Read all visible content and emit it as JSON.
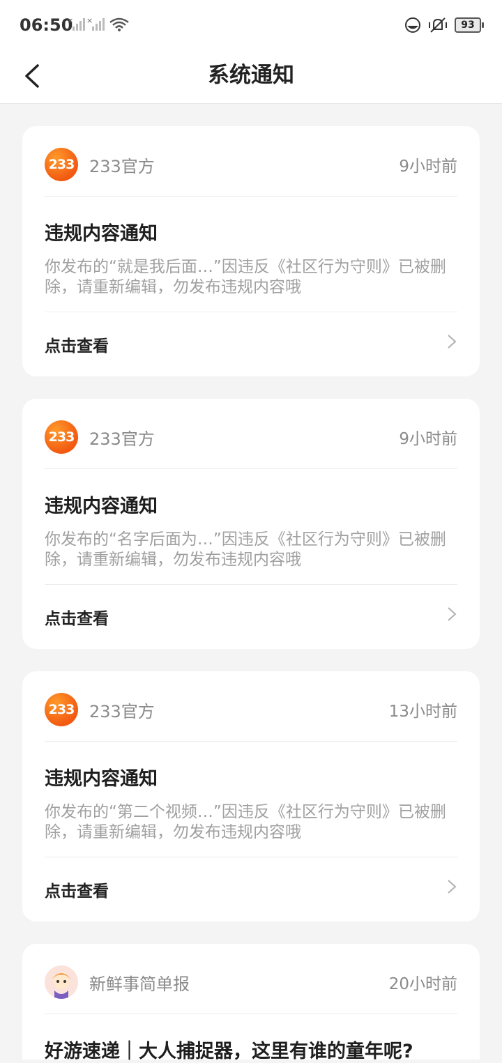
{
  "status_bar": {
    "time": "06:50",
    "battery": "93"
  },
  "header": {
    "title": "系统通知"
  },
  "notifications": [
    {
      "source": "233官方",
      "avatar_text": "233",
      "time": "9小时前",
      "title": "违规内容通知",
      "body": "你发布的“就是我后面…”因违反《社区行为守则》已被删除，请重新编辑，勿发布违规内容哦",
      "action": "点击查看"
    },
    {
      "source": "233官方",
      "avatar_text": "233",
      "time": "9小时前",
      "title": "违规内容通知",
      "body": "你发布的“名字后面为…”因违反《社区行为守则》已被删除，请重新编辑，勿发布违规内容哦",
      "action": "点击查看"
    },
    {
      "source": "233官方",
      "avatar_text": "233",
      "time": "13小时前",
      "title": "违规内容通知",
      "body": "你发布的“第二个视频…”因违反《社区行为守则》已被删除，请重新编辑，勿发布违规内容哦",
      "action": "点击查看"
    },
    {
      "source": "新鲜事简单报",
      "time": "20小时前",
      "title": "好游速递｜大人捕捉器，这里有谁的童年呢?"
    }
  ],
  "colors": {
    "accent": "#f25a12",
    "background": "#f4f4f4",
    "card": "#ffffff"
  }
}
